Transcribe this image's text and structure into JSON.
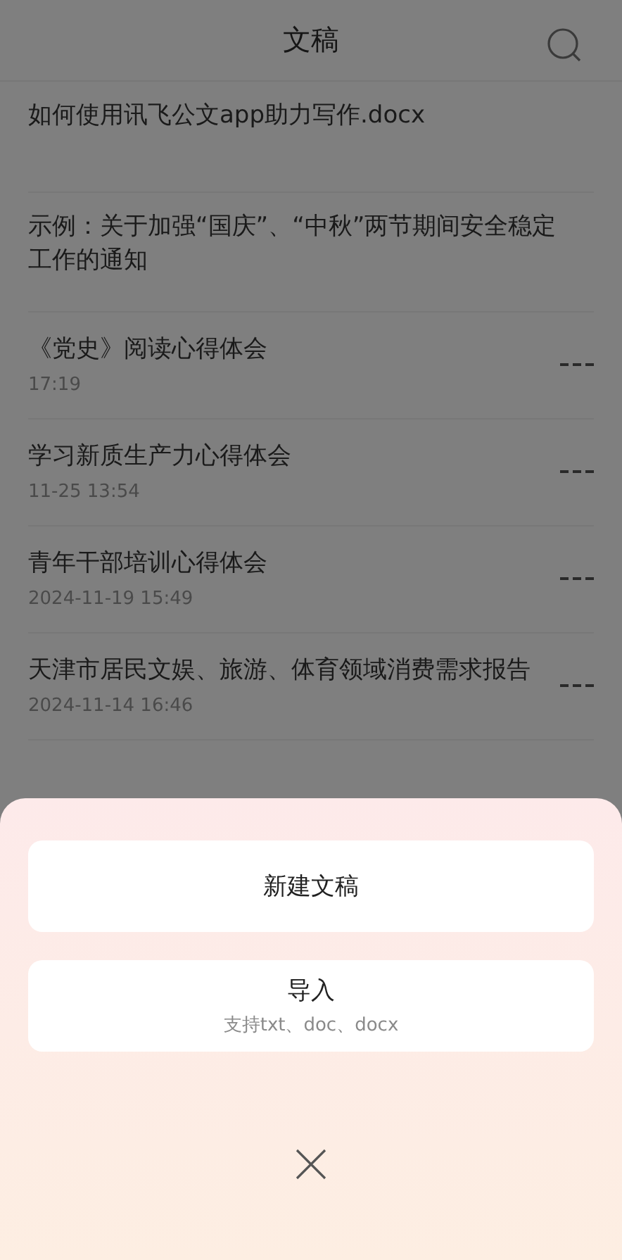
{
  "header": {
    "title": "文稿"
  },
  "documents": [
    {
      "title": "如何使用讯飞公文app助力写作.docx"
    },
    {
      "title": "示例：关于加强“国庆”、“中秋”两节期间安全稳定工作的通知"
    },
    {
      "title": "《党史》阅读心得体会",
      "date": "17:19"
    },
    {
      "title": "学习新质生产力心得体会",
      "date": "11-25 13:54"
    },
    {
      "title": "青年干部培训心得体会",
      "date": "2024-11-19 15:49"
    },
    {
      "title": "天津市居民文娱、旅游、体育领域消费需求报告",
      "date": "2024-11-14 16:46"
    }
  ],
  "sheet": {
    "actions": [
      {
        "label": "新建文稿"
      },
      {
        "label": "导入",
        "hint": "支持txt、doc、docx"
      }
    ]
  }
}
